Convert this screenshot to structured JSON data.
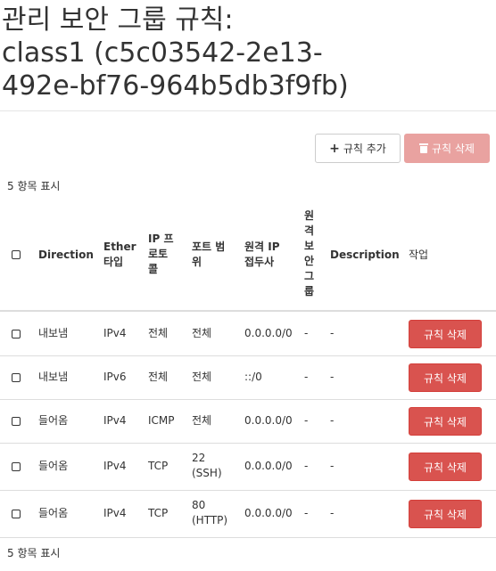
{
  "page": {
    "title_lines": [
      "관리 보안 그룹 규칙:",
      "class1 (c5c03542-2e13-",
      "492e-bf76-964b5db3f9fb)"
    ]
  },
  "toolbar": {
    "add_label": "규칙 추가",
    "delete_label": "규칙 삭제"
  },
  "table": {
    "count_text": "5 항목 표시",
    "headers": {
      "direction": "Direction",
      "ether_lines": [
        "Ether",
        "타입"
      ],
      "ip_proto_lines": [
        "IP 프",
        "로토",
        "콜"
      ],
      "port_lines": [
        "포트 범",
        "위"
      ],
      "remote_ip_lines": [
        "원격 IP",
        "접두사"
      ],
      "remote_group": "원격보안그룹",
      "description": "Description",
      "actions": "작업"
    },
    "rows": [
      {
        "direction": "내보냄",
        "ether": "IPv4",
        "proto": "전체",
        "port": [
          "전체"
        ],
        "remote_ip": "0.0.0.0/0",
        "remote_group": "-",
        "description": "-",
        "action": "규칙 삭제"
      },
      {
        "direction": "내보냄",
        "ether": "IPv6",
        "proto": "전체",
        "port": [
          "전체"
        ],
        "remote_ip": "::/0",
        "remote_group": "-",
        "description": "-",
        "action": "규칙 삭제"
      },
      {
        "direction": "들어옴",
        "ether": "IPv4",
        "proto": "ICMP",
        "port": [
          "전체"
        ],
        "remote_ip": "0.0.0.0/0",
        "remote_group": "-",
        "description": "-",
        "action": "규칙 삭제"
      },
      {
        "direction": "들어옴",
        "ether": "IPv4",
        "proto": "TCP",
        "port": [
          "22",
          "(SSH)"
        ],
        "remote_ip": "0.0.0.0/0",
        "remote_group": "-",
        "description": "-",
        "action": "규칙 삭제"
      },
      {
        "direction": "들어옴",
        "ether": "IPv4",
        "proto": "TCP",
        "port": [
          "80",
          "(HTTP)"
        ],
        "remote_ip": "0.0.0.0/0",
        "remote_group": "-",
        "description": "-",
        "action": "규칙 삭제"
      }
    ]
  }
}
